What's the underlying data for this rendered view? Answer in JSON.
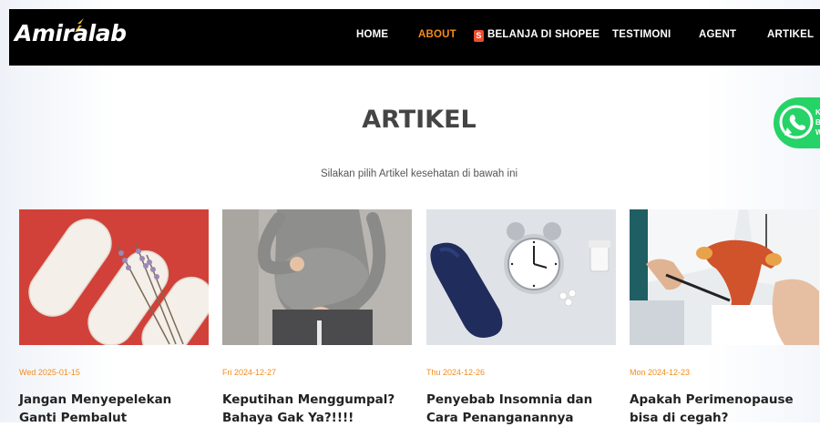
{
  "brand": {
    "logo_text": "Amiralab"
  },
  "nav": {
    "home": "HOME",
    "about": "ABOUT",
    "shopee_icon": "S",
    "shopee": "BELANJA DI SHOPEE",
    "testimoni": "TESTIMONI",
    "agent": "AGENT",
    "artikel": "ARTIKEL"
  },
  "colors": {
    "accent": "#f28c1c",
    "navbar": "#000000",
    "whatsapp": "#25d366"
  },
  "page": {
    "title": "ARTIKEL",
    "subtitle": "Silakan pilih Artikel kesehatan di bawah ini"
  },
  "whatsapp": {
    "icon": "whatsapp-icon",
    "lines": [
      "K",
      "B",
      "W"
    ]
  },
  "articles": [
    {
      "date": "Wed 2025-01-15",
      "title": "Jangan Menyepelekan Ganti Pembalut",
      "image": "sanitary-pads-with-lavender"
    },
    {
      "date": "Fri 2024-12-27",
      "title": "Keputihan Menggumpal? Bahaya Gak Ya?!!!!",
      "image": "pregnant-woman"
    },
    {
      "date": "Thu 2024-12-26",
      "title": "Penyebab Insomnia dan Cara Penanganannya",
      "image": "sleep-mask-and-alarm-clock"
    },
    {
      "date": "Mon 2024-12-23",
      "title": "Apakah Perimenopause bisa di cegah?",
      "image": "doctor-with-uterus-model"
    }
  ]
}
